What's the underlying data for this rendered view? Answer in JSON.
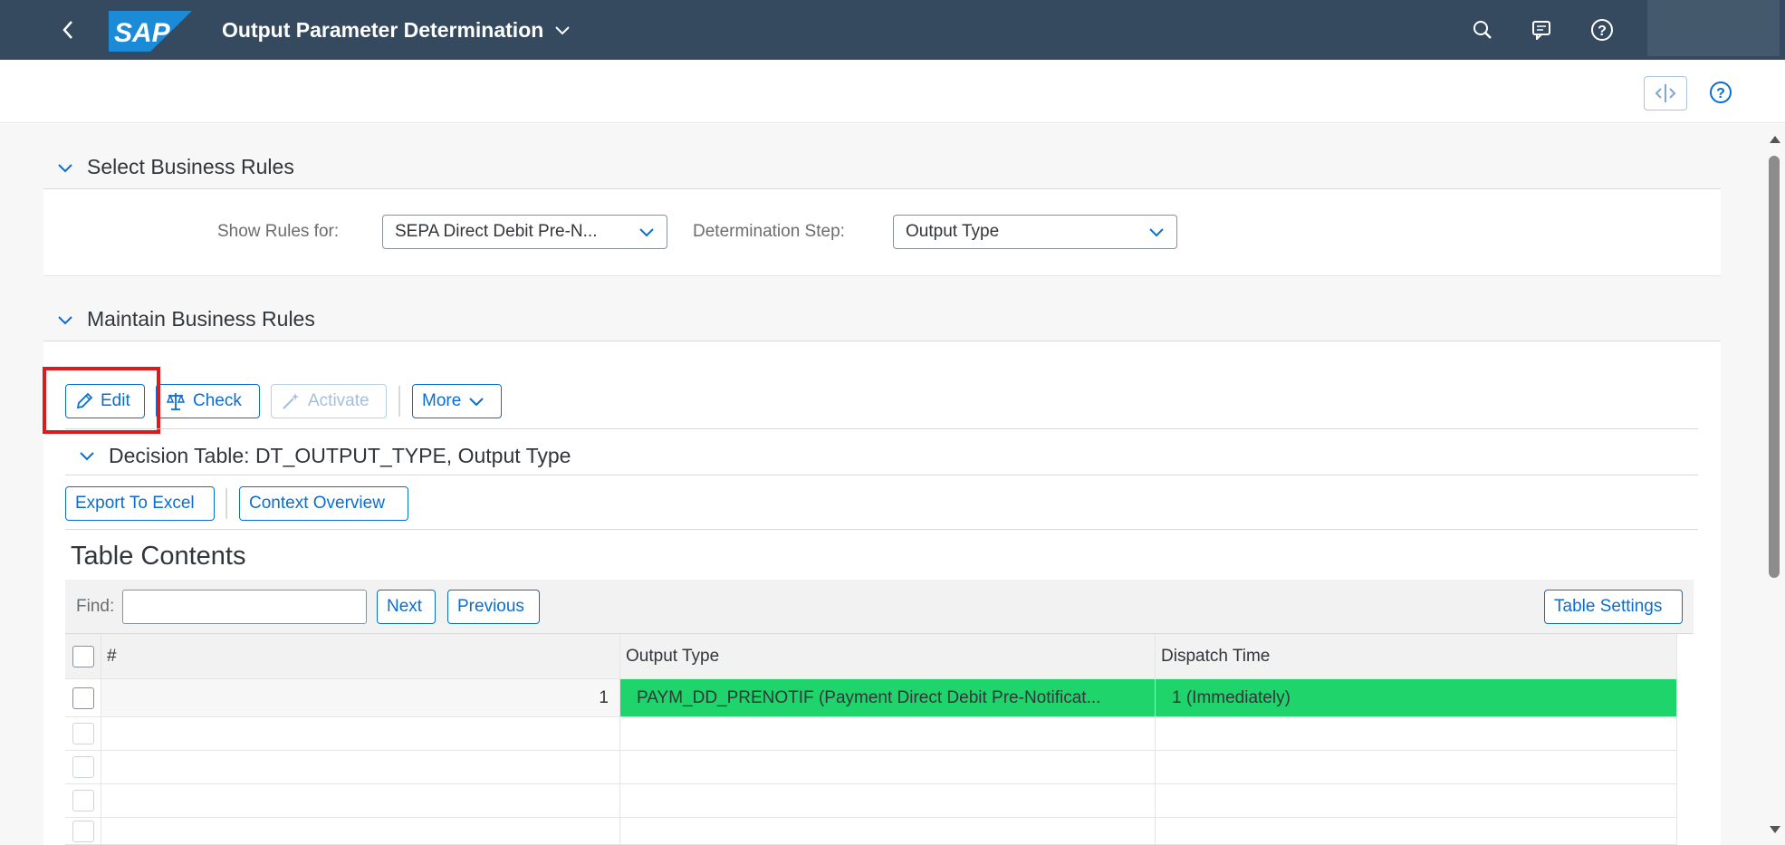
{
  "shell": {
    "title": "Output Parameter Determination",
    "logo_text": "SAP",
    "icons": [
      "back-icon",
      "search-icon",
      "notifications-icon",
      "help-icon"
    ],
    "brand_color": "#354a5f"
  },
  "select_section": {
    "title": "Select Business Rules",
    "show_rules_label": "Show Rules for:",
    "show_rules_value": "SEPA Direct Debit Pre-N...",
    "determination_label": "Determination Step:",
    "determination_value": "Output Type"
  },
  "maintain_section": {
    "title": "Maintain Business Rules",
    "toolbar": {
      "edit": "Edit",
      "check": "Check",
      "activate": "Activate",
      "more": "More"
    },
    "decision_table_title": "Decision Table: DT_OUTPUT_TYPE, Output Type",
    "export_label": "Export To Excel",
    "context_label": "Context Overview",
    "table_contents_title": "Table Contents",
    "find_label": "Find:",
    "find_value": "",
    "next_label": "Next",
    "previous_label": "Previous",
    "table_settings_label": "Table Settings"
  },
  "table": {
    "columns": [
      "#",
      "Output Type",
      "Dispatch Time"
    ],
    "rows": [
      {
        "num": "1",
        "output_type": "PAYM_DD_PRENOTIF (Payment Direct Debit Pre-Notificat...",
        "dispatch_time": "1 (Immediately)"
      }
    ],
    "highlight_color": "#1fd46b"
  },
  "annotation": {
    "color": "#e0191d"
  }
}
